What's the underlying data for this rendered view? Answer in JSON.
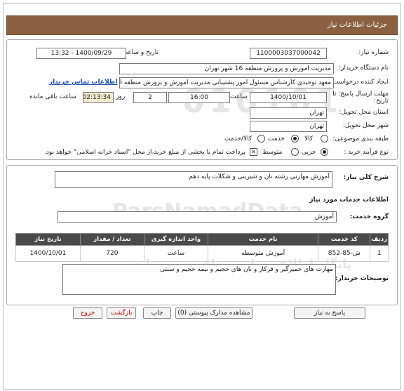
{
  "header": {
    "title": "جزئیات اطلاعات نیاز"
  },
  "form": {
    "need_number_label": "شماره نیاز:",
    "need_number": "1100003037000042",
    "announce_label": "تاریخ و ساعت اعلان عمومی:",
    "announce_value": "1400/09/29 - 13:32",
    "buyer_label": "نام دستگاه خریدار:",
    "buyer_value": "مدیریت اموزش و پرورش منطقه 16 شهر تهران",
    "creator_label": "ایجاد کننده درخواست:",
    "creator_value": "معهد توحیدی کارشناس مسئول امور پشتیبانی مدیریت اموزش و پرورش منطقه 6",
    "contact_link": "اطلاعات تماس خریدار",
    "deadline_label": "مهلت ارسال پاسخ: تا تاریخ:",
    "deadline_date": "1400/10/01",
    "time_label": "ساعت",
    "deadline_time": "16:00",
    "days_value": "2",
    "days_label": "روز و",
    "remaining_value": "02:13:34",
    "remaining_label": "ساعت باقی مانده",
    "province_label": "استان محل تحویل:",
    "province_value": "تهران",
    "city_label": "شهر محل تحویل:",
    "city_value": "تهران",
    "category_label": "طبقه بندی موضوعی:",
    "category_options": [
      "کالا",
      "خدمت",
      "کالا/خدمت"
    ],
    "process_label": "نوع فرآیند خرید :",
    "process_options": [
      "جزیی",
      "متوسط"
    ],
    "payment_note": "پرداخت تمام یا بخشی از مبلغ خرید،از محل \"اسناد خزانه اسلامی\" خواهد بود."
  },
  "description": {
    "label": "شرح کلی نیاز:",
    "value": "آموزش مهارتی رشته نان و شیرینی و شکلات پایه دهم"
  },
  "services": {
    "title": "اطلاعات خدمات مورد نیاز",
    "group_label": "گروه خدمت:",
    "group_value": "آموزش",
    "columns": [
      "ردیف",
      "کد خدمت",
      "نام خدمت",
      "واحد اندازه گیری",
      "تعداد / مقدار",
      "تاریخ نیاز"
    ],
    "rows": [
      [
        "1",
        "ش-85-852",
        "آموزش متوسطه",
        "ساعت",
        "720",
        "1400/10/01"
      ]
    ]
  },
  "buyer_notes": {
    "label": "توضیحات خریدار:",
    "value": "مهارت های خمیرگیر و فرکار و نان های حجیم و نیمه حجیم و سنتی"
  },
  "buttons": {
    "reply": "پاسخ به نیاز",
    "attachments": "مشاهده مدارک پیوستی (0)",
    "print": "چاپ",
    "back": "بازگشت",
    "exit": "خروج"
  },
  "watermark": {
    "brand": "ParsNamadData",
    "text": "پایگاه اطلاع رسانی مناقصه و مزایده",
    "phone": "021-88349670"
  }
}
